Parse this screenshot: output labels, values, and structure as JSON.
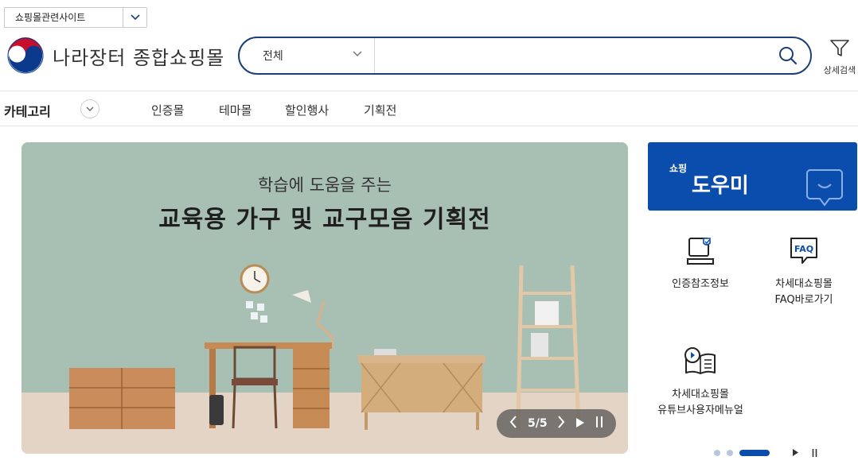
{
  "header": {
    "related_sites": "쇼핑몰관련사이트",
    "logo_text": "나라장터 종합쇼핑몰",
    "search_scope": "전체",
    "search_value": "",
    "advanced_search": "상세검색"
  },
  "nav": {
    "category": "카테고리",
    "menu": [
      "인증몰",
      "테마몰",
      "할인행사",
      "기획전"
    ]
  },
  "banner": {
    "subtitle": "학습에 도움을 주는",
    "title": "교육용 가구 및 교구모음 기획전",
    "page": "5/5"
  },
  "helper": {
    "small": "쇼핑",
    "big": "도우미"
  },
  "quick_links": [
    {
      "label_1": "인증참조정보",
      "label_2": "",
      "icon": "laptop-shield-icon"
    },
    {
      "label_1": "차세대쇼핑몰",
      "label_2": "FAQ바로가기",
      "icon": "faq-icon"
    },
    {
      "label_1": "차세대쇼핑몰",
      "label_2": "유튜브사용자메뉴얼",
      "icon": "video-book-icon"
    }
  ],
  "colors": {
    "brand_blue": "#0b4dad",
    "search_border": "#1d3f78",
    "banner_bg": "#a8bfb3"
  }
}
